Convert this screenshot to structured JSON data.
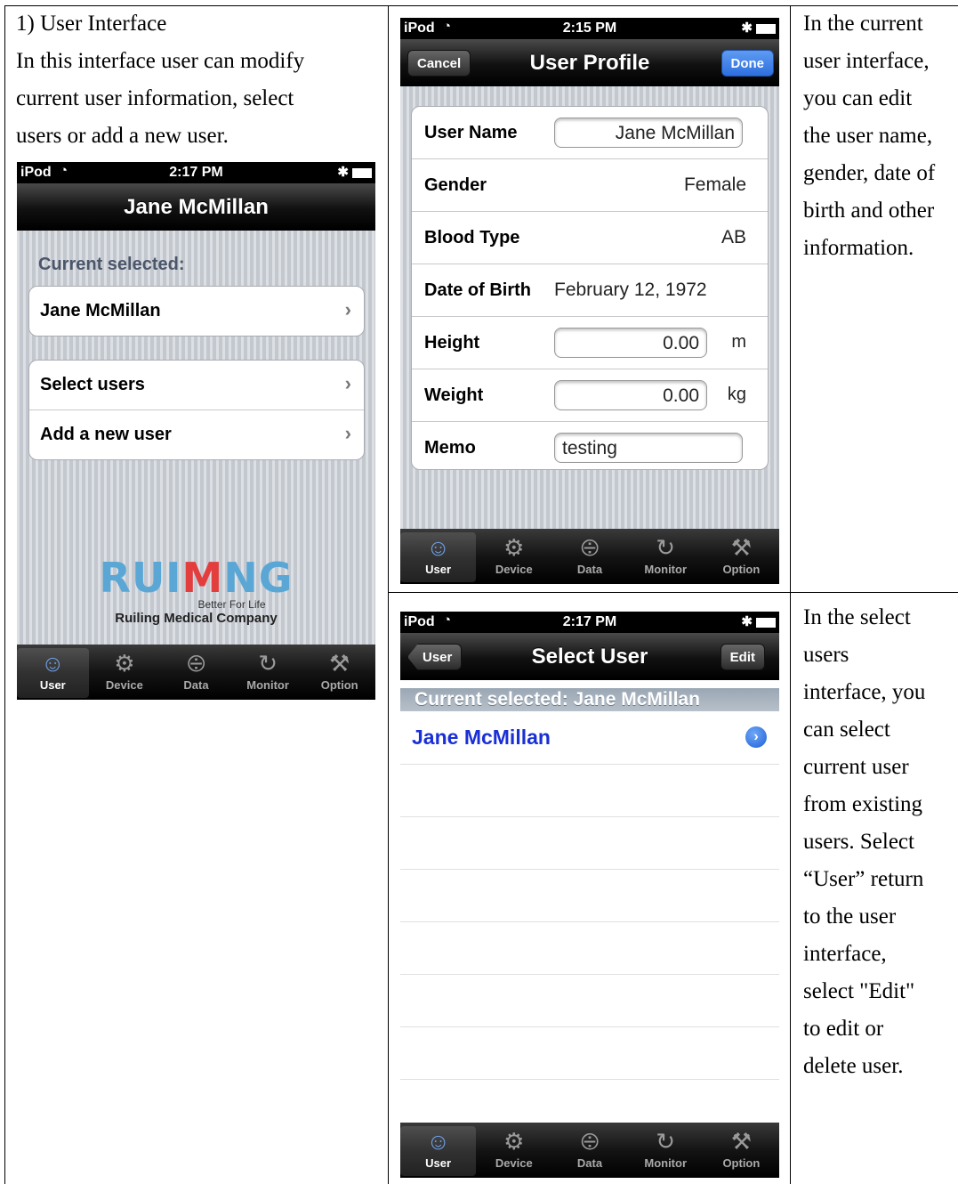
{
  "doc": {
    "left_text": [
      "1) User Interface",
      "In this interface user can modify",
      "current user information, select",
      "users or add a new user."
    ],
    "right_top_text": [
      "In the current",
      "user interface,",
      "you can edit",
      "the user name,",
      "gender, date of",
      "birth and other",
      "information."
    ],
    "right_bottom_text": [
      "In the select",
      "users",
      "interface, you",
      "can select",
      "current user",
      "from existing",
      "users. Select",
      "“User” return",
      "to the user",
      "interface,",
      "select \"Edit\"",
      "to edit or",
      "delete user."
    ]
  },
  "tabs": [
    {
      "label": "User",
      "icon": "user-icon"
    },
    {
      "label": "Device",
      "icon": "gear-icon"
    },
    {
      "label": "Data",
      "icon": "chart-icon"
    },
    {
      "label": "Monitor",
      "icon": "refresh-icon"
    },
    {
      "label": "Option",
      "icon": "tools-icon"
    }
  ],
  "phone1": {
    "carrier": "iPod",
    "time": "2:17 PM",
    "title": "Jane McMillan",
    "section_header": "Current selected:",
    "current_user": "Jane McMillan",
    "menu": [
      "Select users",
      "Add a new user"
    ],
    "logo_text": "RUIMING",
    "logo_tagline": "Better For Life",
    "company": "Ruiling Medical Company"
  },
  "phone2": {
    "carrier": "iPod",
    "time": "2:15 PM",
    "title": "User Profile",
    "left_button": "Cancel",
    "right_button": "Done",
    "fields": {
      "user_name_label": "User Name",
      "user_name": "Jane McMillan",
      "gender_label": "Gender",
      "gender": "Female",
      "blood_label": "Blood Type",
      "blood": "AB",
      "dob_label": "Date of Birth",
      "dob": "February 12, 1972",
      "height_label": "Height",
      "height": "0.00",
      "height_unit": "m",
      "weight_label": "Weight",
      "weight": "0.00",
      "weight_unit": "kg",
      "memo_label": "Memo",
      "memo": "testing"
    }
  },
  "phone3": {
    "carrier": "iPod",
    "time": "2:17 PM",
    "title": "Select User",
    "back_button": "User",
    "right_button": "Edit",
    "section_header": "Current selected: Jane McMillan",
    "users": [
      "Jane McMillan"
    ]
  },
  "colors": {
    "accent_blue": "#2d6fe0",
    "link_blue": "#1a2fd6",
    "logo_blue": "#5aa7d6",
    "logo_red": "#e43d3d"
  }
}
